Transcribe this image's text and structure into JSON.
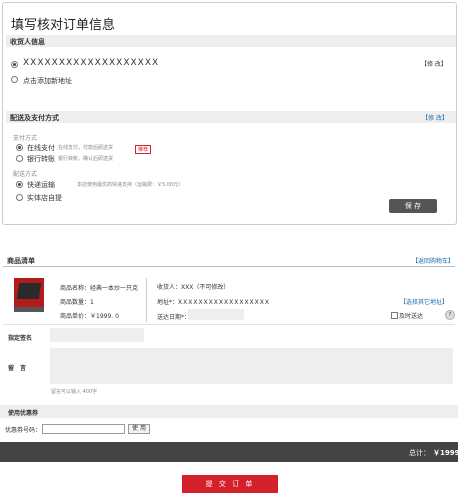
{
  "page": {
    "title": "填写核对订单信息"
  },
  "receiver": {
    "section_title": "收货人信息",
    "address_text": "XXXXXXXXXXXXXXXXXXX",
    "modify_label": "【修 改】",
    "add_new_label": "点击添加新地址"
  },
  "delivery": {
    "section_title": "配送及支付方式",
    "modify_label": "【修 改】",
    "pay_heading": "支付方式",
    "pay_options": [
      {
        "label": "在线支付",
        "desc": "在线支付，付款后即送货",
        "selected": true
      },
      {
        "label": "银行转账",
        "desc": "银行转账，确认后即送货",
        "selected": false
      }
    ],
    "pay_badge": "推荐",
    "ship_heading": "配送方式",
    "ship_options": [
      {
        "label": "快递运输",
        "desc": "本店使用最优的快递支持（运输费：￥5.00元）",
        "selected": true
      },
      {
        "label": "实体店自提",
        "desc": "",
        "selected": false
      }
    ],
    "save_label": "保 存"
  },
  "goods": {
    "section_title": "商品清单",
    "back_link": "【返回购物车】",
    "product_name_label": "商品名称：",
    "product_name": "经典一本炒一只克",
    "product_qty_label": "商品数量：",
    "product_qty": "1",
    "product_price_label": "商品单价：",
    "product_price": "￥1999. 0",
    "receiver_label": "收货人：",
    "receiver_value": "XXX（不可修改）",
    "address_label": "地址*：",
    "address_value": "XXXXXXXXXXXXXXXXXX",
    "select_address_link": "【选择其它地址】",
    "ship_date_label": "送达日期*：",
    "ship_date_value": "",
    "timely_label": "及时送达",
    "help_icon_text": "?",
    "signature_label": "指定签名",
    "message_label": "留　言",
    "message_hint": "留言可以输入 400字"
  },
  "coupon": {
    "section_title": "使用优惠券",
    "code_label": "优惠券号码：",
    "use_label": "使 用"
  },
  "total": {
    "label": "总计：",
    "value": "￥1999"
  },
  "submit": {
    "label": "提 交 订 单"
  },
  "colors": {
    "accent_red": "#d4202a",
    "link_blue": "#1a6fb0",
    "dark_bar": "#444444"
  }
}
